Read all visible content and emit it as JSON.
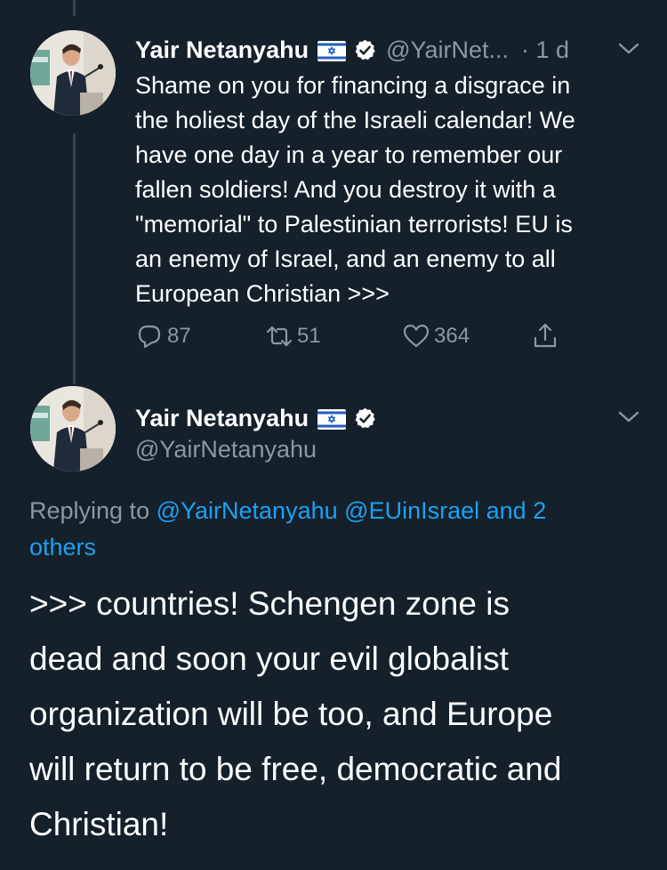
{
  "colors": {
    "background": "#15202b",
    "text_primary": "#ffffff",
    "text_secondary": "#8899a6",
    "link": "#1da1f2",
    "thread_line": "#38444d",
    "like_icon": "#8899a6"
  },
  "tweet1": {
    "display_name": "Yair Netanyahu",
    "flag_icon": "israel-flag-icon",
    "verified_icon": "verified-badge-icon",
    "handle": "@YairNet...",
    "time": "· 1 d",
    "menu_icon": "chevron-down-icon",
    "body_lines": [
      "Shame on you for financing a disgrace in",
      "the holiest day of the Israeli calendar! We",
      "have one day in a year to remember our",
      "fallen soldiers! And you destroy it with a",
      "\"memorial\" to Palestinian terrorists! EU is",
      "an enemy of Israel, and an enemy to all",
      "European Christian >>>"
    ],
    "actions": {
      "reply_count": "87",
      "retweet_count": "51",
      "like_count": "364"
    }
  },
  "tweet2": {
    "display_name": "Yair Netanyahu",
    "flag_icon": "israel-flag-icon",
    "verified_icon": "verified-badge-icon",
    "handle": "@YairNetanyahu",
    "menu_icon": "chevron-down-icon",
    "replying_prefix": "Replying to",
    "replying_mention_1": "@YairNetanyahu",
    "replying_mention_2": "@EUinIsrael",
    "replying_others_line1": "and 2",
    "replying_others_line2": "others",
    "body_lines": [
      ">>> countries! Schengen zone is",
      "dead and soon your evil globalist",
      "organization will be too, and Europe",
      "will return to be free, democratic and",
      "Christian!"
    ]
  }
}
